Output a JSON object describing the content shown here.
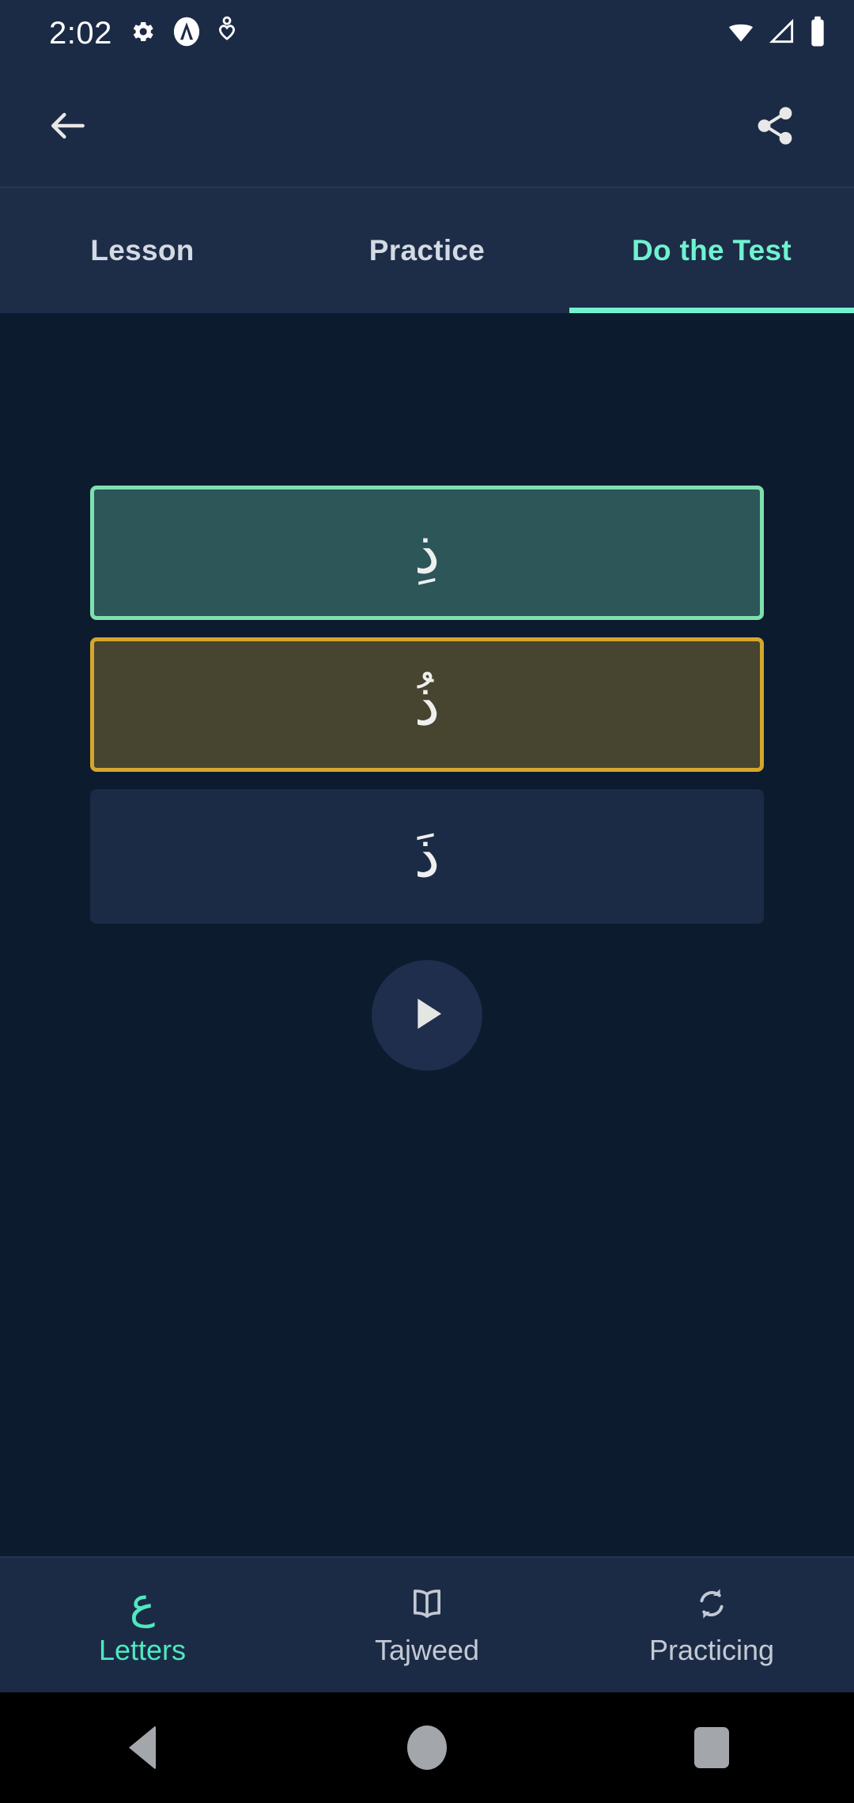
{
  "status_bar": {
    "time": "2:02",
    "left_icons": [
      "gear-icon",
      "app-logo-icon",
      "location-heart-icon"
    ],
    "right_icons": [
      "wifi-icon",
      "cellular-signal-icon",
      "battery-icon"
    ]
  },
  "app_bar": {
    "back_icon": "back-arrow-icon",
    "share_icon": "share-icon"
  },
  "tabs": {
    "items": [
      {
        "label": "Lesson",
        "active": false
      },
      {
        "label": "Practice",
        "active": false
      },
      {
        "label": "Do the Test",
        "active": true
      }
    ],
    "active_color": "#6FF2D0",
    "inactive_color": "#D4DAE4"
  },
  "test": {
    "options": [
      {
        "letter": "ذِ",
        "state": "correct",
        "border_color": "#7EE0B0",
        "fill_color": "#2D5659"
      },
      {
        "letter": "ذُ",
        "state": "selected",
        "border_color": "#D4A72C",
        "fill_color": "#474430"
      },
      {
        "letter": "ذَ",
        "state": "default",
        "border_color": "transparent",
        "fill_color": "#1C2B45"
      }
    ],
    "play_button": {
      "icon": "play-icon",
      "background": "#1E2E4C"
    }
  },
  "bottom_nav": {
    "items": [
      {
        "label": "Letters",
        "icon": "arabic-ain-letter-icon",
        "glyph": "ع",
        "active": true
      },
      {
        "label": "Tajweed",
        "icon": "open-book-icon",
        "glyph": "",
        "active": false
      },
      {
        "label": "Practicing",
        "icon": "sync-refresh-icon",
        "glyph": "",
        "active": false
      }
    ],
    "active_color": "#4FE8C0",
    "inactive_color": "#C3C9D4"
  },
  "system_nav": {
    "back": "back-triangle-icon",
    "home": "home-circle-icon",
    "recents": "recents-square-icon"
  },
  "theme": {
    "background": "#0D1B2E",
    "surface": "#1C2B45",
    "accent": "#6FF2D0"
  }
}
